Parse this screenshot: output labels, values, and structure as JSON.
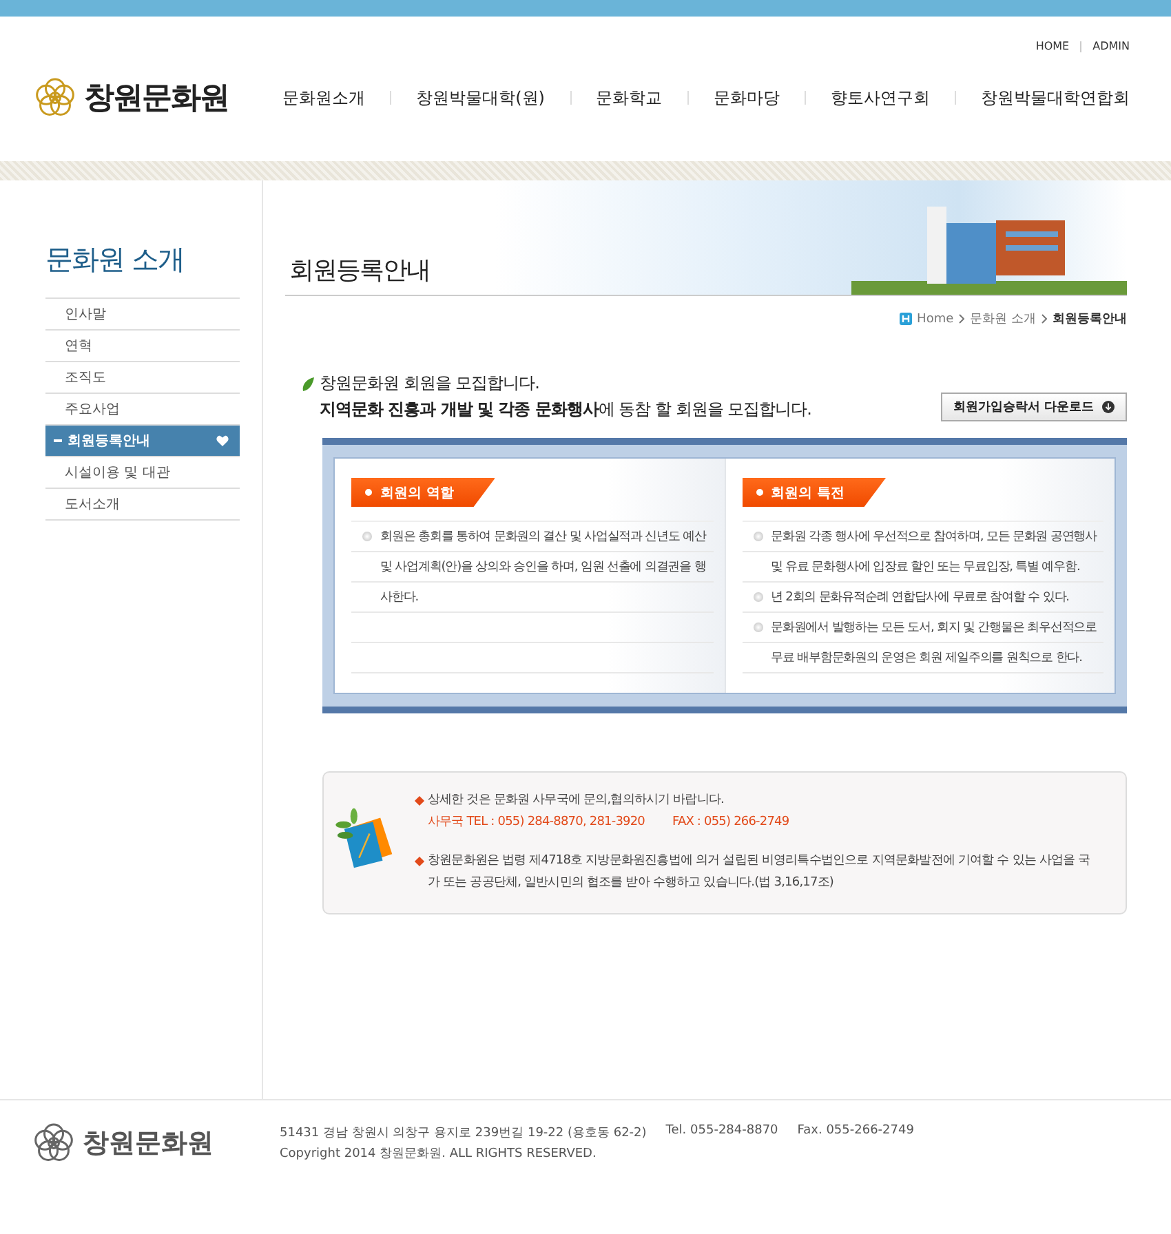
{
  "top_links": [
    "HOME",
    "ADMIN"
  ],
  "logo": {
    "text": "창원문화원"
  },
  "nav": [
    "문화원소개",
    "창원박물대학(원)",
    "문화학교",
    "문화마당",
    "향토사연구회",
    "창원박물대학연합회"
  ],
  "sidebar": {
    "title": "문화원 소개",
    "items": [
      {
        "label": "인사말",
        "selected": false
      },
      {
        "label": "연혁",
        "selected": false
      },
      {
        "label": "조직도",
        "selected": false
      },
      {
        "label": "주요사업",
        "selected": false
      },
      {
        "label": "회원등록안내",
        "selected": true
      },
      {
        "label": "시설이용 및 대관",
        "selected": false
      },
      {
        "label": "도서소개",
        "selected": false
      }
    ]
  },
  "page_title": "회원등록안내",
  "breadcrumb": [
    "Home",
    "문화원 소개",
    "회원등록안내"
  ],
  "intro": {
    "line_1": "창원문화원 회원을 모집합니다.",
    "line_2": "**지역문화 진흥과 개발 및 각종 문화행사**에 동참 할 회원을 모집합니다."
  },
  "download_button": "회원가입승락서 다운로드",
  "panels": [
    {
      "title": "회원의 역할",
      "items": [
        "회원은 총회를 통하여 문화원의 결산 및 사업실적과 신년도 예산 및 사업계획(안)을 상의와 승인을 하며, 임원 선출에 의결권을 행사한다."
      ]
    },
    {
      "title": "회원의 특전",
      "items": [
        "문화원 각종 행사에 우선적으로 참여하며, 모든 문화원 공연행사 및 유료 문화행사에 입장료 할인 또는 무료입장, 특별 예우함.",
        "년 2회의 문화유적순례 연합답사에 무료로 참여할 수 있다.",
        "문화원에서 발행하는 모든 도서, 회지 및 간행물은 최우선적으로 무료 배부함문화원의 운영은 회원 제일주의를 원칙으로 한다."
      ]
    }
  ],
  "notice": [
    {
      "text": "상세한 것은 문화원 사무국에 문의,협의하시기 바랍니다.",
      "contacts": [
        "사무국 TEL : 055) 284-8870, 281-3920",
        "FAX : 055) 266-2749"
      ]
    },
    {
      "text": "창원문화원은 법령 제4718호 지방문화원진흥법에 의거 설립된 비영리특수법인으로 지역문화발전에 기여할 수 있는 사업을 국가 또는 공공단체, 일반시민의 협조를 받아 수행하고 있습니다.(법 3,16,17조)"
    }
  ],
  "footer": {
    "logo": "창원문화원",
    "address": "51431 경남 창원시 의창구 용지로 239번길 19-22 (용호동 62-2)",
    "tel": "Tel. 055-284-8870",
    "fax": "Fax. 055-266-2749",
    "copyright": "Copyright 2014 창원문화원. ALL RIGHTS RESERVED."
  }
}
